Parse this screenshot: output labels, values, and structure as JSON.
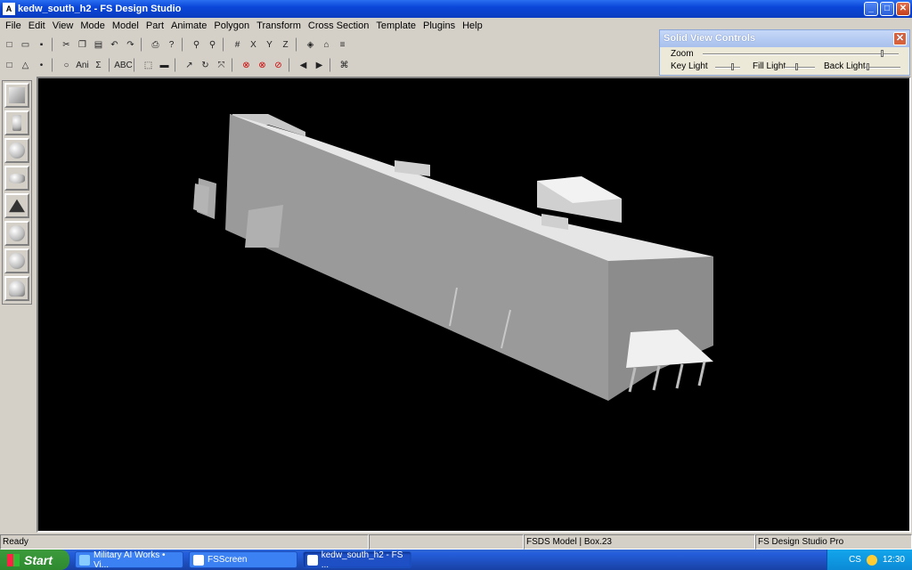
{
  "window": {
    "title": "kedw_south_h2 - FS Design Studio"
  },
  "menu": [
    "File",
    "Edit",
    "View",
    "Mode",
    "Model",
    "Part",
    "Animate",
    "Polygon",
    "Transform",
    "Cross Section",
    "Template",
    "Plugins",
    "Help"
  ],
  "toolbar1": [
    "new-icon",
    "open-icon",
    "save-icon",
    "sep",
    "cut-icon",
    "copy-icon",
    "paste-icon",
    "undo-icon",
    "redo-icon",
    "sep",
    "print-icon",
    "help-icon",
    "sep",
    "zoom-in-icon",
    "zoom-out-icon",
    "sep",
    "grid-icon",
    "align-x-icon",
    "align-y-icon",
    "align-z-icon",
    "sep",
    "wireframe-icon",
    "house-icon",
    "properties-icon"
  ],
  "toolbar2": [
    "select-icon",
    "triangle-icon",
    "point-icon",
    "sep",
    "circle-icon",
    "ani-icon",
    "sigma-icon",
    "sep",
    "text-icon",
    "sep",
    "marquee-icon",
    "ruler-icon",
    "sep",
    "arrow-icon",
    "rotate-icon",
    "scale-icon",
    "sep",
    "delete-icon",
    "delete-part-icon",
    "delete-all-icon",
    "sep",
    "prev-icon",
    "next-icon",
    "sep",
    "binoculars-icon"
  ],
  "toolbar2_labels": {
    "ani": "Ani",
    "sigma": "Σ",
    "text": "ABC"
  },
  "solid_view": {
    "title": "Solid View Controls",
    "zoom": "Zoom",
    "key_light": "Key Light",
    "fill_light": "Fill Light",
    "back_light": "Back Light"
  },
  "left_tools": [
    "box-tool",
    "cylinder-tool",
    "sphere-tool",
    "ellipsoid-tool",
    "pyramid-tool",
    "geosphere-tool",
    "geosphere2-tool",
    "hemisphere-tool"
  ],
  "status": {
    "ready": "Ready",
    "model": "FSDS Model | Box.23",
    "edition": "FS Design Studio Pro"
  },
  "taskbar": {
    "start": "Start",
    "tasks": [
      "Military AI Works • Vi...",
      "FSScreen",
      "kedw_south_h2 - FS ..."
    ],
    "lang": "CS",
    "clock": "12:30"
  },
  "colors": {
    "viewport": "#000000",
    "model": "#9a9a9a"
  }
}
